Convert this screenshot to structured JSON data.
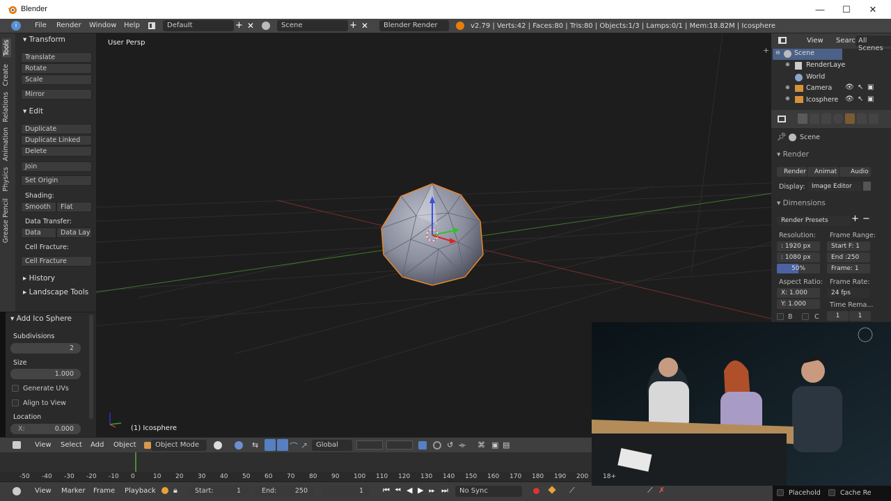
{
  "window": {
    "title": "Blender",
    "minimize": "—",
    "maximize": "☐",
    "close": "✕"
  },
  "menubar": {
    "menus": [
      "File",
      "Render",
      "Window",
      "Help"
    ],
    "layout": "Default",
    "scene": "Scene",
    "engine": "Blender Render",
    "stats": "v2.79 | Verts:42 | Faces:80 | Tris:80 | Objects:1/3 | Lamps:0/1 | Mem:18.82M | Icosphere"
  },
  "toolshelf": {
    "tabs": [
      "Tools",
      "Create",
      "Relations",
      "Animation",
      "Physics",
      "Grease Pencil"
    ],
    "transform_header": "Transform",
    "transform": [
      "Translate",
      "Rotate",
      "Scale",
      "Mirror"
    ],
    "edit_header": "Edit",
    "edit": [
      "Duplicate",
      "Duplicate Linked",
      "Delete",
      "Join",
      "Set Origin"
    ],
    "shading_label": "Shading:",
    "shading": [
      "Smooth",
      "Flat"
    ],
    "data_transfer_label": "Data Transfer:",
    "data_transfer": [
      "Data",
      "Data Lay"
    ],
    "cell_fracture_label": "Cell Fracture:",
    "cell_fracture_btn": "Cell Fracture",
    "history": "History",
    "landscape": "Landscape Tools"
  },
  "operator": {
    "title": "Add Ico Sphere",
    "subdivisions_label": "Subdivisions",
    "subdivisions": "2",
    "size_label": "Size",
    "size": "1.000",
    "generate_uvs": "Generate UVs",
    "align_to_view": "Align to View",
    "location_label": "Location",
    "x_label": "X:",
    "x": "0.000"
  },
  "viewport": {
    "view_label": "User Persp",
    "object_label": "(1) Icosphere"
  },
  "viewport_header": {
    "menus": [
      "View",
      "Select",
      "Add",
      "Object"
    ],
    "mode": "Object Mode",
    "orientation": "Global"
  },
  "timeline": {
    "ticks": [
      "-50",
      "-40",
      "-30",
      "-20",
      "-10",
      "0",
      "10",
      "20",
      "30",
      "40",
      "50",
      "60",
      "70",
      "80",
      "90",
      "100",
      "110",
      "120",
      "130",
      "140",
      "150",
      "160",
      "170",
      "180",
      "190",
      "200"
    ],
    "menus": [
      "View",
      "Marker",
      "Frame",
      "Playback"
    ],
    "start_label": "Start:",
    "start": "1",
    "end_label": "End:",
    "end": "250",
    "current": "1",
    "sync": "No Sync",
    "placeholder": "Placehold",
    "cache": "Cache Re"
  },
  "outliner": {
    "tabs": [
      "View",
      "Search",
      "All Scenes"
    ],
    "items": [
      "Scene",
      "RenderLaye",
      "World",
      "Camera",
      "Icosphere"
    ]
  },
  "properties": {
    "context": "Scene",
    "render_header": "Render",
    "render_buttons": [
      "Render",
      "Animat",
      "Audio"
    ],
    "display_label": "Display:",
    "display": "Image Editor",
    "dimensions_header": "Dimensions",
    "presets": "Render Presets",
    "resolution_label": "Resolution:",
    "res_x": ": 1920 px",
    "res_y": ": 1080 px",
    "res_pct": "50%",
    "frame_range_label": "Frame Range:",
    "start_f": "Start F: 1",
    "end_f": "End :250",
    "frame": "Frame: 1",
    "aspect_label": "Aspect Ratio:",
    "aspect_x": "X:  1.000",
    "aspect_y": "Y:  1.000",
    "frame_rate_label": "Frame Rate:",
    "fps": "24 fps",
    "time_remap": "Time Rema...",
    "tr_a": "1",
    "tr_b": "1",
    "b_label": "B",
    "c_label": "C"
  },
  "webcam": {
    "badge": "18+"
  },
  "colors": {
    "selection_outline": "#e8882a",
    "x_axis": "#b33",
    "y_axis": "#3a3",
    "z_axis": "#33c"
  }
}
